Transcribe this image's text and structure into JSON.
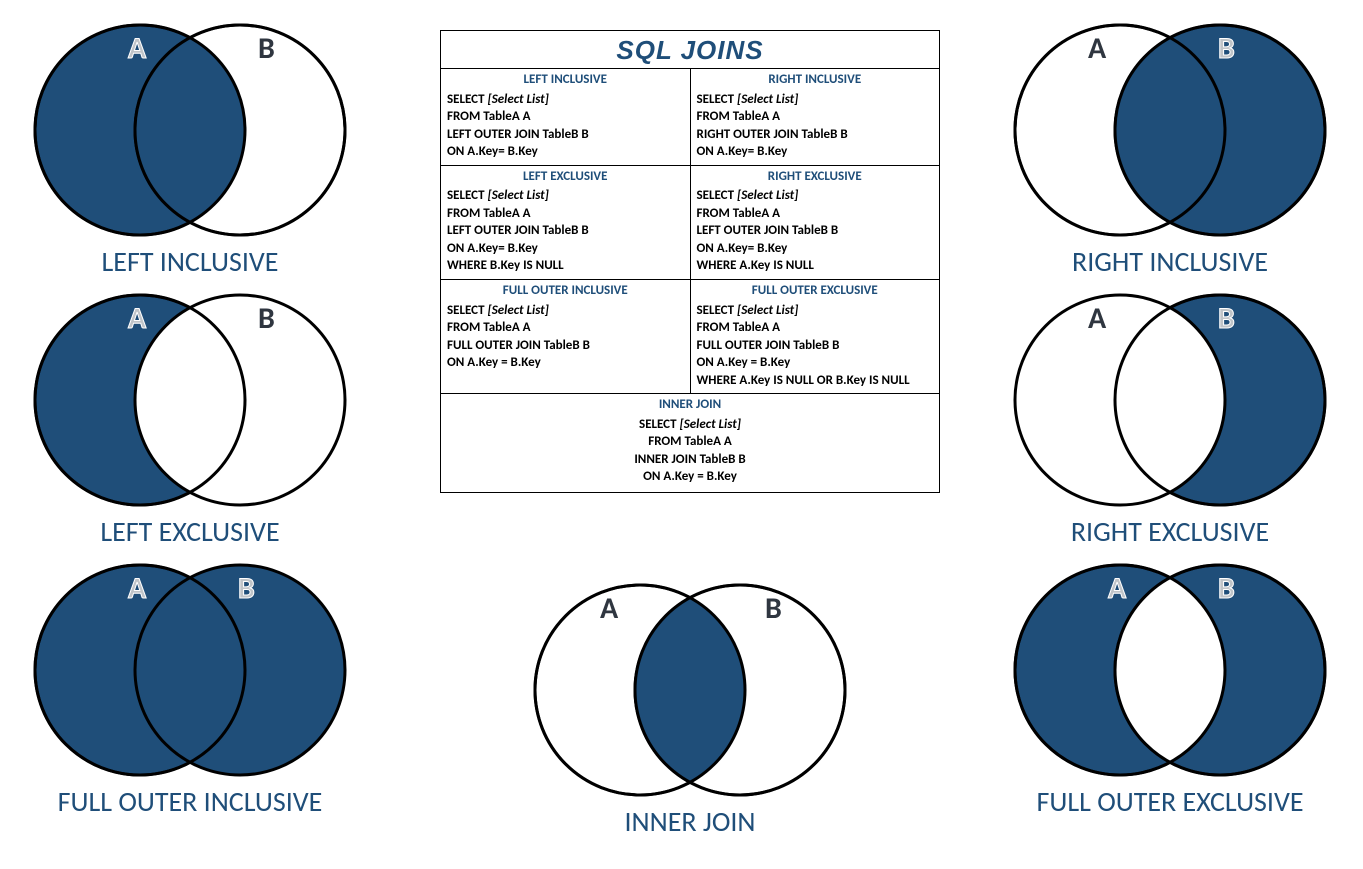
{
  "title": "SQL JOINS",
  "labels": {
    "A": "A",
    "B": "B"
  },
  "diagrams": {
    "left_inclusive": {
      "caption": "LEFT INCLUSIVE"
    },
    "right_inclusive": {
      "caption": "RIGHT INCLUSIVE"
    },
    "left_exclusive": {
      "caption": "LEFT EXCLUSIVE"
    },
    "right_exclusive": {
      "caption": "RIGHT EXCLUSIVE"
    },
    "full_outer_inclusive": {
      "caption": "FULL OUTER INCLUSIVE"
    },
    "full_outer_exclusive": {
      "caption": "FULL OUTER EXCLUSIVE"
    },
    "inner_join": {
      "caption": "INNER JOIN"
    }
  },
  "cells": {
    "left_inclusive": {
      "title": "LEFT INCLUSIVE",
      "l1a": "SELECT ",
      "l1b": "[Select List]",
      "l2": "FROM TableA A",
      "l3": "LEFT OUTER JOIN TableB B",
      "l4": "ON A.Key= B.Key"
    },
    "right_inclusive": {
      "title": "RIGHT INCLUSIVE",
      "l1a": "SELECT ",
      "l1b": "[Select List]",
      "l2": "FROM TableA A",
      "l3": "RIGHT OUTER JOIN TableB B",
      "l4": "ON A.Key= B.Key"
    },
    "left_exclusive": {
      "title": "LEFT EXCLUSIVE",
      "l1a": "SELECT ",
      "l1b": "[Select List]",
      "l2": "FROM TableA A",
      "l3": "LEFT OUTER JOIN TableB B",
      "l4": "ON A.Key= B.Key",
      "l5": "WHERE B.Key IS NULL"
    },
    "right_exclusive": {
      "title": "RIGHT EXCLUSIVE",
      "l1a": "SELECT ",
      "l1b": "[Select List]",
      "l2": "FROM TableA A",
      "l3": "LEFT OUTER JOIN TableB B",
      "l4": "ON A.Key= B.Key",
      "l5": "WHERE A.Key IS NULL"
    },
    "full_outer_inclusive": {
      "title": "FULL OUTER INCLUSIVE",
      "l1a": "SELECT ",
      "l1b": "[Select List]",
      "l2": "FROM TableA A",
      "l3": "FULL OUTER JOIN TableB B",
      "l4": "ON A.Key = B.Key"
    },
    "full_outer_exclusive": {
      "title": "FULL OUTER EXCLUSIVE",
      "l1a": "SELECT ",
      "l1b": "[Select List]",
      "l2": "FROM TableA A",
      "l3": "FULL OUTER JOIN TableB B",
      "l4": "ON A.Key = B.Key",
      "l5": "WHERE A.Key IS NULL OR B.Key IS NULL"
    },
    "inner_join": {
      "title": "INNER JOIN",
      "l1a": "SELECT ",
      "l1b": "[Select List]",
      "l2": "FROM TableA A",
      "l3": "INNER JOIN TableB B",
      "l4": "ON A.Key = B.Key"
    }
  },
  "colors": {
    "fill": "#1f4e79",
    "stroke": "#000000"
  }
}
